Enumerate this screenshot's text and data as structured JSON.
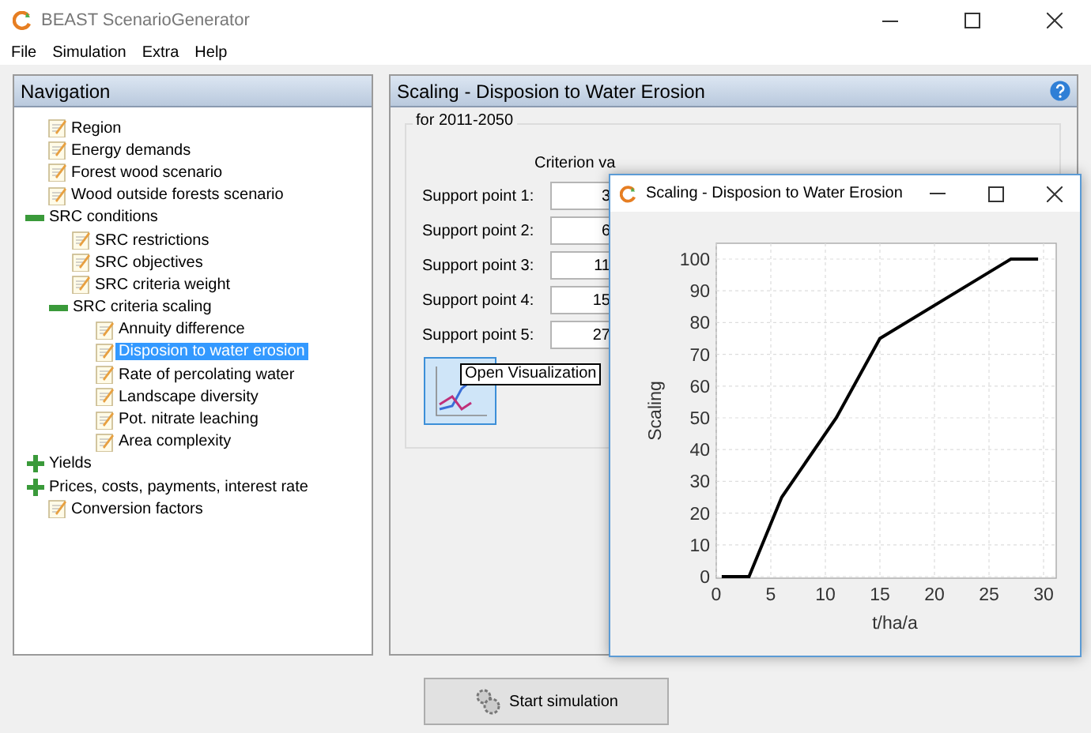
{
  "window": {
    "title": "BEAST ScenarioGenerator"
  },
  "menu": [
    "File",
    "Simulation",
    "Extra",
    "Help"
  ],
  "navigation": {
    "title": "Navigation",
    "items": [
      {
        "label": "Region",
        "kind": "leaf",
        "selected": false
      },
      {
        "label": "Energy demands",
        "kind": "leaf",
        "selected": false
      },
      {
        "label": "Forest wood scenario",
        "kind": "leaf",
        "selected": false
      },
      {
        "label": "Wood outside forests scenario",
        "kind": "leaf",
        "selected": false
      },
      {
        "label": "SRC conditions",
        "kind": "group",
        "expanded": true,
        "selected": false,
        "children": [
          {
            "label": "SRC restrictions",
            "kind": "leaf",
            "selected": false
          },
          {
            "label": "SRC objectives",
            "kind": "leaf",
            "selected": false
          },
          {
            "label": "SRC criteria weight",
            "kind": "leaf",
            "selected": false
          },
          {
            "label": "SRC criteria scaling",
            "kind": "group",
            "expanded": true,
            "selected": false,
            "children": [
              {
                "label": "Annuity difference",
                "kind": "leaf",
                "selected": false
              },
              {
                "label": "Disposion to water erosion",
                "kind": "leaf",
                "selected": true
              },
              {
                "label": "Rate of percolating water",
                "kind": "leaf",
                "selected": false
              },
              {
                "label": "Landscape diversity",
                "kind": "leaf",
                "selected": false
              },
              {
                "label": "Pot. nitrate leaching",
                "kind": "leaf",
                "selected": false
              },
              {
                "label": "Area complexity",
                "kind": "leaf",
                "selected": false
              }
            ]
          }
        ]
      },
      {
        "label": "Yields",
        "kind": "group",
        "expanded": false,
        "selected": false
      },
      {
        "label": "Prices, costs, payments, interest rate",
        "kind": "group",
        "expanded": false,
        "selected": false
      },
      {
        "label": "Conversion factors",
        "kind": "leaf",
        "selected": false
      }
    ]
  },
  "scaling_panel": {
    "title": "Scaling - Disposion to Water Erosion",
    "group_title": "for 2011-2050",
    "column_header": "Criterion va",
    "support_points": [
      {
        "label": "Support point 1:",
        "value": "3"
      },
      {
        "label": "Support point 2:",
        "value": "6"
      },
      {
        "label": "Support point 3:",
        "value": "11"
      },
      {
        "label": "Support point 4:",
        "value": "15"
      },
      {
        "label": "Support point 5:",
        "value": "27"
      }
    ],
    "tooltip": "Open Visualization"
  },
  "start_button": "Start simulation",
  "chart_window": {
    "title": "Scaling - Disposion to Water Erosion",
    "chart_data": {
      "type": "line",
      "xlabel": "t/ha/a",
      "ylabel": "Scaling",
      "x": [
        0.5,
        3,
        6,
        11,
        15,
        27,
        29.5
      ],
      "grid": true,
      "series": [
        {
          "color": "#000000",
          "values": [
            0,
            0,
            25,
            50,
            75,
            100,
            100
          ]
        }
      ],
      "xlim": [
        0,
        30
      ],
      "ylim": [
        0,
        100
      ],
      "xticks": [
        0,
        5,
        10,
        15,
        20,
        25,
        30
      ],
      "yticks": [
        0,
        10,
        20,
        30,
        40,
        50,
        60,
        70,
        80,
        90,
        100
      ]
    }
  }
}
